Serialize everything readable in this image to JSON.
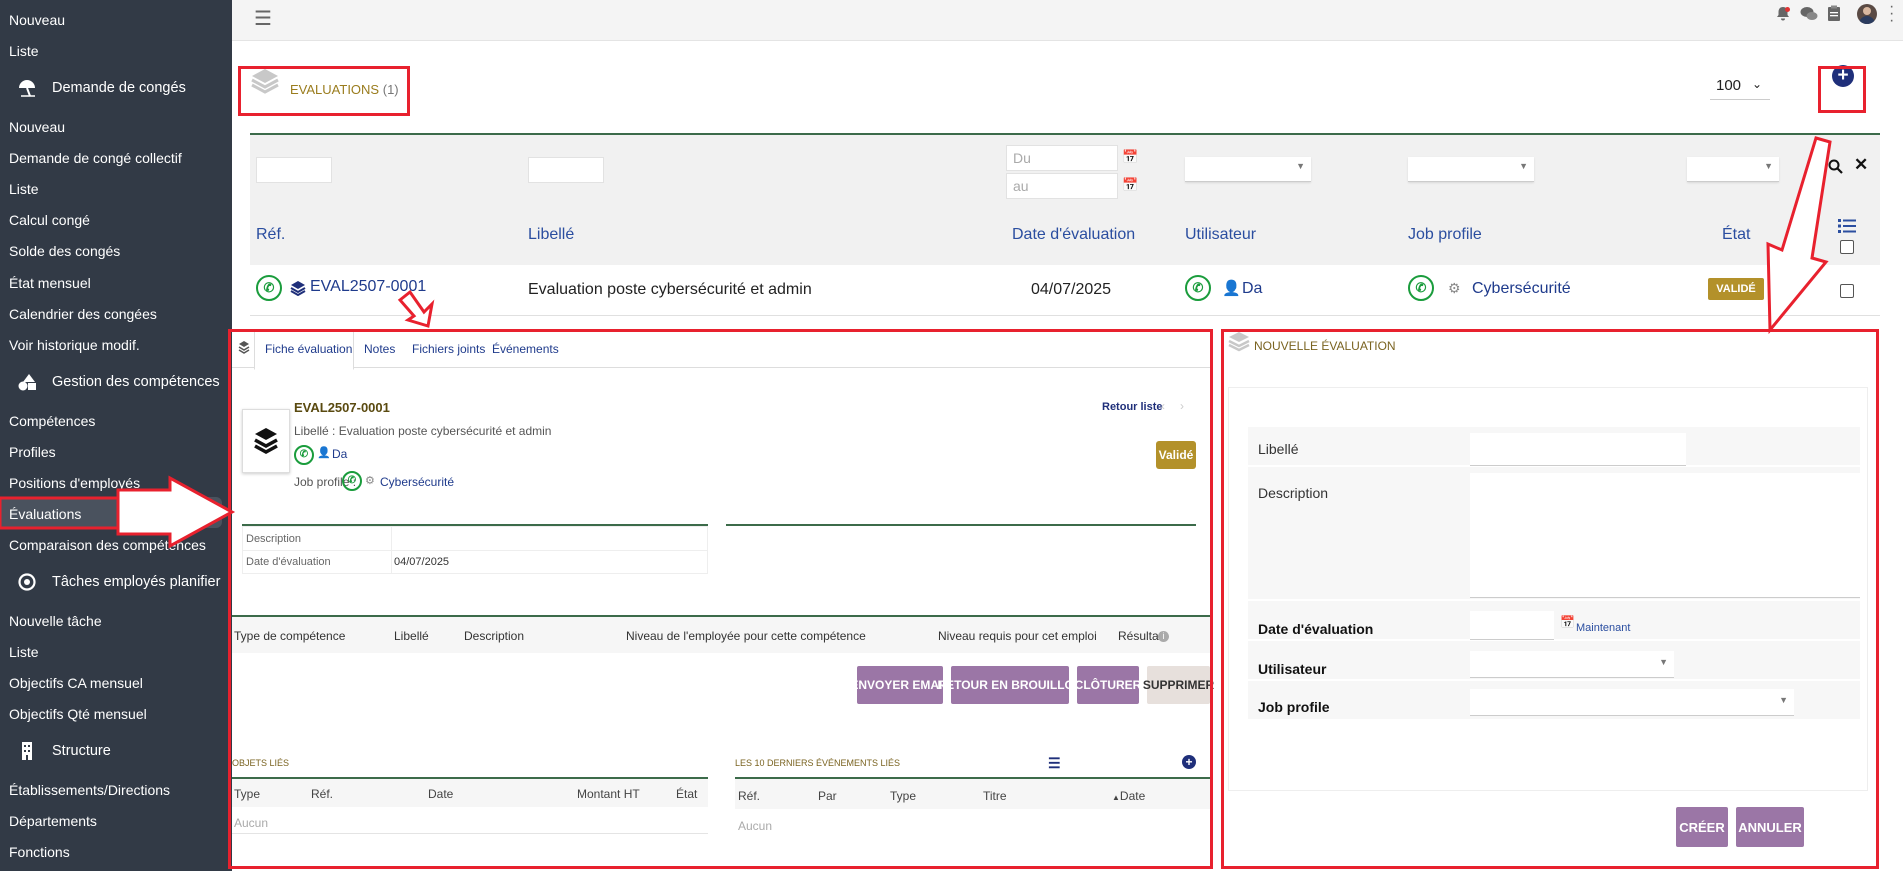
{
  "sidebar": {
    "items": [
      {
        "label": "Nouveau"
      },
      {
        "label": "Liste"
      },
      {
        "label": "Demande de congés",
        "section": true,
        "icon": "beach-umbrella-icon"
      },
      {
        "label": "Nouveau"
      },
      {
        "label": "Demande de congé collectif"
      },
      {
        "label": "Liste"
      },
      {
        "label": "Calcul congé"
      },
      {
        "label": "Solde des congés"
      },
      {
        "label": "État mensuel"
      },
      {
        "label": "Calendrier des congées"
      },
      {
        "label": "Voir historique modif."
      },
      {
        "label": "Gestion des compétences",
        "section": true,
        "icon": "shapes-icon"
      },
      {
        "label": "Compétences"
      },
      {
        "label": "Profiles"
      },
      {
        "label": "Positions d'employés"
      },
      {
        "label": "Évaluations",
        "active": true
      },
      {
        "label": "Comparaison des compétences"
      },
      {
        "label": "Tâches employés planifier",
        "section": true,
        "icon": "target-icon"
      },
      {
        "label": "Nouvelle tâche"
      },
      {
        "label": "Liste"
      },
      {
        "label": "Objectifs CA mensuel"
      },
      {
        "label": "Objectifs Qté mensuel"
      },
      {
        "label": "Structure",
        "section": true,
        "icon": "building-icon"
      },
      {
        "label": "Établissements/Directions"
      },
      {
        "label": "Départements"
      },
      {
        "label": "Fonctions"
      }
    ]
  },
  "topbar": {
    "icons": [
      "menu-icon",
      "bell-icon",
      "chat-icon",
      "clipboard-icon",
      "avatar",
      "more-icon"
    ]
  },
  "list": {
    "title": "EVALUATIONS",
    "count": "(1)",
    "page_size": "100",
    "filters": {
      "du_placeholder": "Du",
      "au_placeholder": "au"
    },
    "columns": [
      "Réf.",
      "Libellé",
      "Date d'évaluation",
      "Utilisateur",
      "Job profile",
      "État"
    ],
    "rows": [
      {
        "ref": "EVAL2507-0001",
        "libelle": "Evaluation poste cybersécurité et admin",
        "date": "04/07/2025",
        "user": "Da",
        "job": "Cybersécurité",
        "etat": "VALIDÉ"
      }
    ]
  },
  "card": {
    "tabs": [
      "Fiche évaluation",
      "Notes",
      "Fichiers joints",
      "Événements"
    ],
    "ref": "EVAL2507-0001",
    "libelle_line": "Libellé : Evaluation poste cybersécurité et admin",
    "user": "Da",
    "job_label": "Job profile :",
    "job": "Cybersécurité",
    "retour": "Retour liste",
    "status": "Validé",
    "fields": [
      {
        "label": "Description",
        "value": ""
      },
      {
        "label": "Date d'évaluation",
        "value": "04/07/2025"
      }
    ],
    "comp_cols": [
      "Type de compétence",
      "Libellé",
      "Description",
      "Niveau de l'employée pour cette compétence",
      "Niveau requis pour cet emploi",
      "Résultat"
    ],
    "buttons": {
      "email": "ENVOYER EMAIL",
      "brouillon": "RETOUR EN BROUILLON",
      "cloturer": "CLÔTURER",
      "supprimer": "SUPPRIMER"
    },
    "linked": {
      "title": "OBJETS LIÉS",
      "cols": [
        "Type",
        "Réf.",
        "Date",
        "Montant HT",
        "État"
      ],
      "empty": "Aucun"
    },
    "events": {
      "title": "LES 10 DERNIERS ÉVÉNEMENTS LIÉS",
      "cols": [
        "Réf.",
        "Par",
        "Type",
        "Titre",
        "Date"
      ],
      "empty": "Aucun"
    }
  },
  "form": {
    "title": "NOUVELLE ÉVALUATION",
    "fields": {
      "libelle": "Libellé",
      "description": "Description",
      "date": "Date d'évaluation",
      "maintenant": "Maintenant",
      "utilisateur": "Utilisateur",
      "job": "Job profile"
    },
    "buttons": {
      "creer": "CRÉER",
      "annuler": "ANNULER"
    }
  },
  "colors": {
    "sidebar": "#323a46",
    "accent": "#2b4ea0",
    "gold": "#b3912a",
    "purple": "#9b76a6",
    "annotation_red": "#e8212e",
    "whatsapp_green": "#1a9c3c"
  }
}
